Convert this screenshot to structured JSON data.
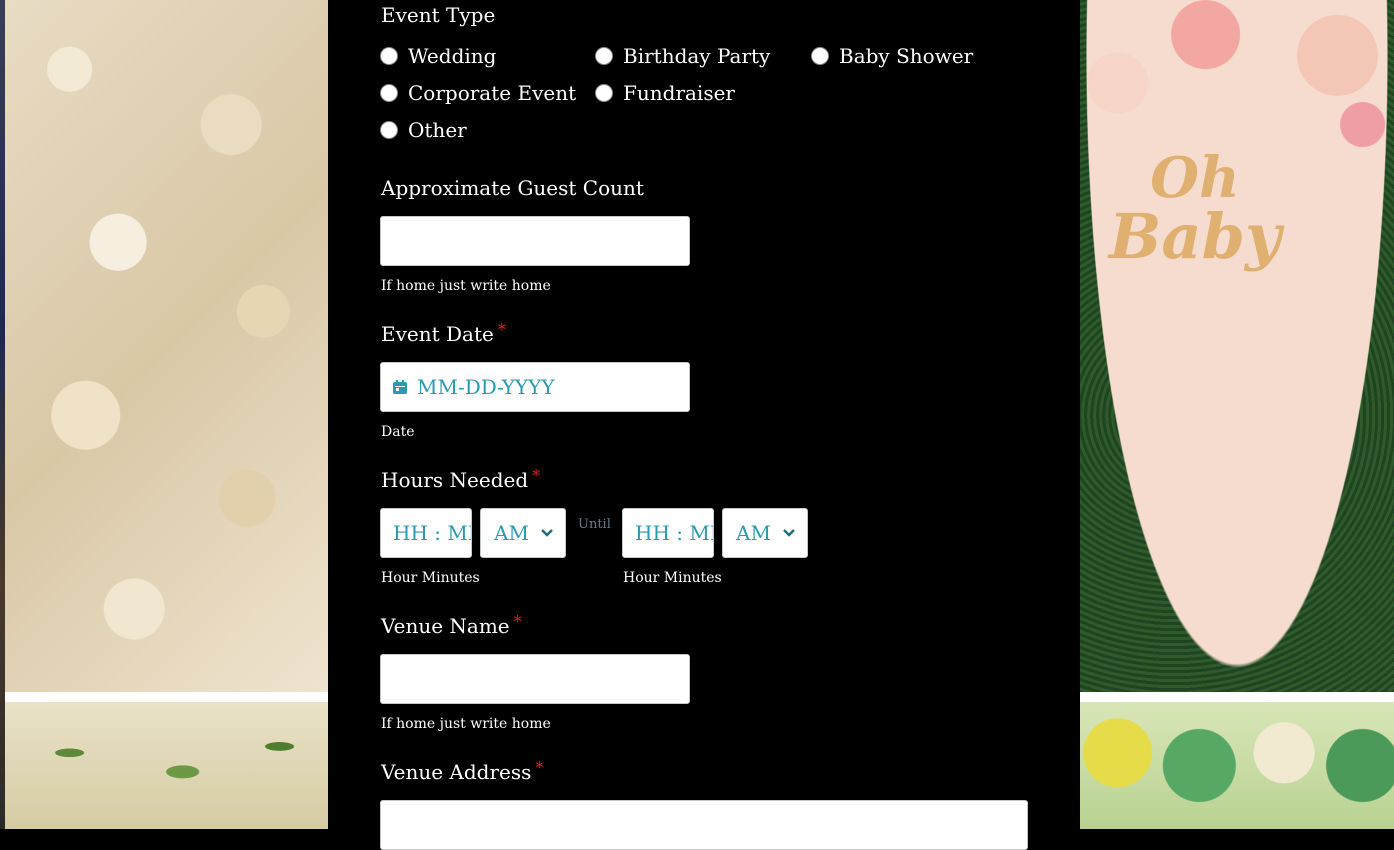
{
  "form": {
    "event_type": {
      "label": "Event Type",
      "options": [
        "Wedding",
        "Birthday Party",
        "Baby Shower",
        "Corporate Event",
        "Fundraiser",
        "Other"
      ]
    },
    "guest_count": {
      "label": "Approximate Guest Count",
      "value": "",
      "placeholder": "",
      "sublabel": "If home just write home"
    },
    "event_date": {
      "label": "Event Date",
      "required_mark": "*",
      "placeholder": "MM-DD-YYYY",
      "sublabel": "Date"
    },
    "hours_needed": {
      "label": "Hours Needed",
      "required_mark": "*",
      "start_time_placeholder": "HH : MM",
      "start_ampm": "AM",
      "until": "Until",
      "end_time_placeholder": "HH : MM",
      "end_ampm": "AM",
      "start_sublabel": "Hour Minutes",
      "end_sublabel": "Hour Minutes"
    },
    "venue_name": {
      "label": "Venue Name",
      "required_mark": "*",
      "value": "",
      "sublabel": "If home just write home"
    },
    "venue_address": {
      "label": "Venue Address",
      "required_mark": "*",
      "value": ""
    }
  },
  "decor": {
    "right_sign_line1": "Oh",
    "right_sign_line2": "Baby"
  },
  "colors": {
    "background": "#000000",
    "required": "#e02020",
    "placeholder": "#2a9ab0"
  }
}
